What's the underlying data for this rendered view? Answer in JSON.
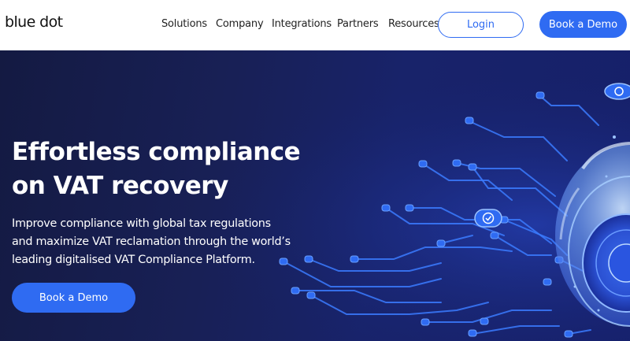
{
  "header": {
    "logo": "blue dot",
    "nav": [
      {
        "label": "Solutions"
      },
      {
        "label": "Company"
      },
      {
        "label": "Integrations"
      },
      {
        "label": "Partners"
      },
      {
        "label": "Resources"
      }
    ],
    "login_label": "Login",
    "demo_label": "Book a Demo"
  },
  "hero": {
    "title_line1": "Effortless compliance",
    "title_line2": "on VAT recovery",
    "subtitle_line1": "Improve compliance with global tax regulations",
    "subtitle_line2": "and maximize VAT reclamation through the world’s",
    "subtitle_line3": "leading digitalised VAT Compliance Platform.",
    "cta_label": "Book a Demo",
    "illustration": "circuit-board-with-shield-dome"
  },
  "colors": {
    "accent": "#2f6bf2",
    "hero_bg": "#18205a",
    "circuit": "#3b7bff"
  }
}
